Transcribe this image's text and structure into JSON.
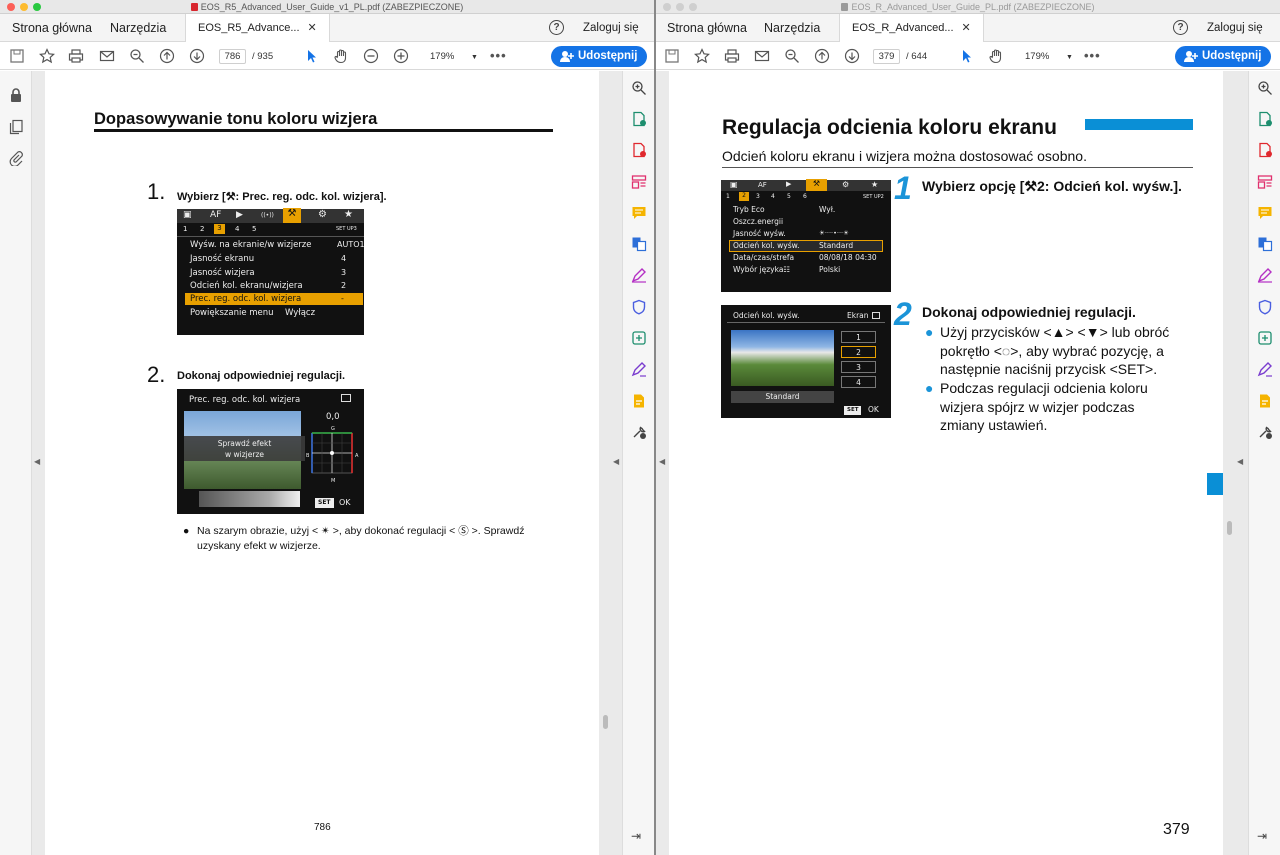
{
  "left": {
    "window_title": "EOS_R5_Advanced_User_Guide_v1_PL.pdf (ZABEZPIECZONE)",
    "tabs": {
      "home": "Strona główna",
      "tools": "Narzędzia",
      "doc": "EOS_R5_Advance..."
    },
    "login": "Zaloguj się",
    "page_current": "786",
    "page_total": "/ 935",
    "zoom": "179%",
    "share": "Udostępnij",
    "heading": "Dopasowywanie tonu koloru wizjera",
    "step1_num": "1.",
    "step1_text": "Wybierz [⚒:  Prec. reg. odc. kol. wizjera].",
    "menu": {
      "tabs": [
        "▣",
        "AF",
        "▶",
        "((•))",
        "⚒",
        "⚙",
        "★"
      ],
      "subtabs": [
        "1",
        "2",
        "3",
        "4",
        "5"
      ],
      "setup": "SET UP3",
      "rows": [
        {
          "label": "Wyśw. na ekranie/w wizjerze",
          "value": "AUTO1"
        },
        {
          "label": "Jasność ekranu",
          "value": "4"
        },
        {
          "label": "Jasność wizjera",
          "value": "3"
        },
        {
          "label": "Odcień kol. ekranu/wizjera",
          "value": "2"
        },
        {
          "label": "Prec. reg. odc. kol. wizjera",
          "value": "-"
        },
        {
          "label": "Powiększanie menu",
          "value": "Wyłącz"
        }
      ]
    },
    "step2_num": "2.",
    "step2_text": "Dokonaj odpowiedniej regulacji.",
    "adj": {
      "title": "Prec. reg. odc. kol. wizjera",
      "value": "0,0",
      "overlay1": "Sprawdź efekt",
      "overlay2": "w wizjerze",
      "g": "G",
      "b": "B",
      "a": "A",
      "m": "M",
      "set": "SET",
      "ok": "OK"
    },
    "bullet": "Na szarym obrazie, użyj < ✴ >, aby dokonać regulacji < Ⓢ >. Sprawdź uzyskany efekt w wizjerze.",
    "page_label": "786"
  },
  "right": {
    "window_title": "EOS_R_Advanced_User_Guide_PL.pdf (ZABEZPIECZONE)",
    "tabs": {
      "home": "Strona główna",
      "tools": "Narzędzia",
      "doc": "EOS_R_Advanced..."
    },
    "login": "Zaloguj się",
    "page_current": "379",
    "page_total": "/ 644",
    "zoom": "179%",
    "share": "Udostępnij",
    "heading": "Regulacja odcienia koloru ekranu",
    "subtitle": "Odcień koloru ekranu i wizjera można dostosować osobno.",
    "menu": {
      "tabs": [
        "▣",
        "AF",
        "▶",
        "⚒",
        "⚙",
        "★"
      ],
      "subtabs": [
        "1",
        "2",
        "3",
        "4",
        "5",
        "6"
      ],
      "setup": "SET UP2",
      "rows": [
        {
          "label": "Tryb Eco",
          "value": "Wył."
        },
        {
          "label": "Oszcz.energii",
          "value": ""
        },
        {
          "label": "Jasność wyśw.",
          "value": "☀····•···☀"
        },
        {
          "label": "Odcień kol. wyśw.",
          "value": "Standard"
        },
        {
          "label": "Data/czas/strefa",
          "value": "08/08/18 04:30"
        },
        {
          "label": "Wybór języka☷",
          "value": "Polski"
        }
      ]
    },
    "step1_num": "1",
    "step1_text": "Wybierz opcję [⚒2: Odcień kol. wyśw.].",
    "tone": {
      "title": "Odcień kol. wyśw.",
      "ekran": "Ekran",
      "options": [
        "1",
        "2",
        "3",
        "4"
      ],
      "standard": "Standard",
      "set": "SET",
      "ok": "OK"
    },
    "step2_num": "2",
    "step2_text": "Dokonaj odpowiedniej regulacji.",
    "bullet1": "Użyj przycisków <▲> <▼> lub obróć pokrętło <◌>, aby wybrać pozycję, a następnie naciśnij przycisk <SET>.",
    "bullet2": "Podczas regulacji odcienia koloru wizjera spójrz w wizjer podczas zmiany ustawień.",
    "page_label": "379"
  },
  "colors": {
    "accent": "#1473e6",
    "heading_bar": "#0a8fd6",
    "menu_highlight": "#f0a500"
  }
}
